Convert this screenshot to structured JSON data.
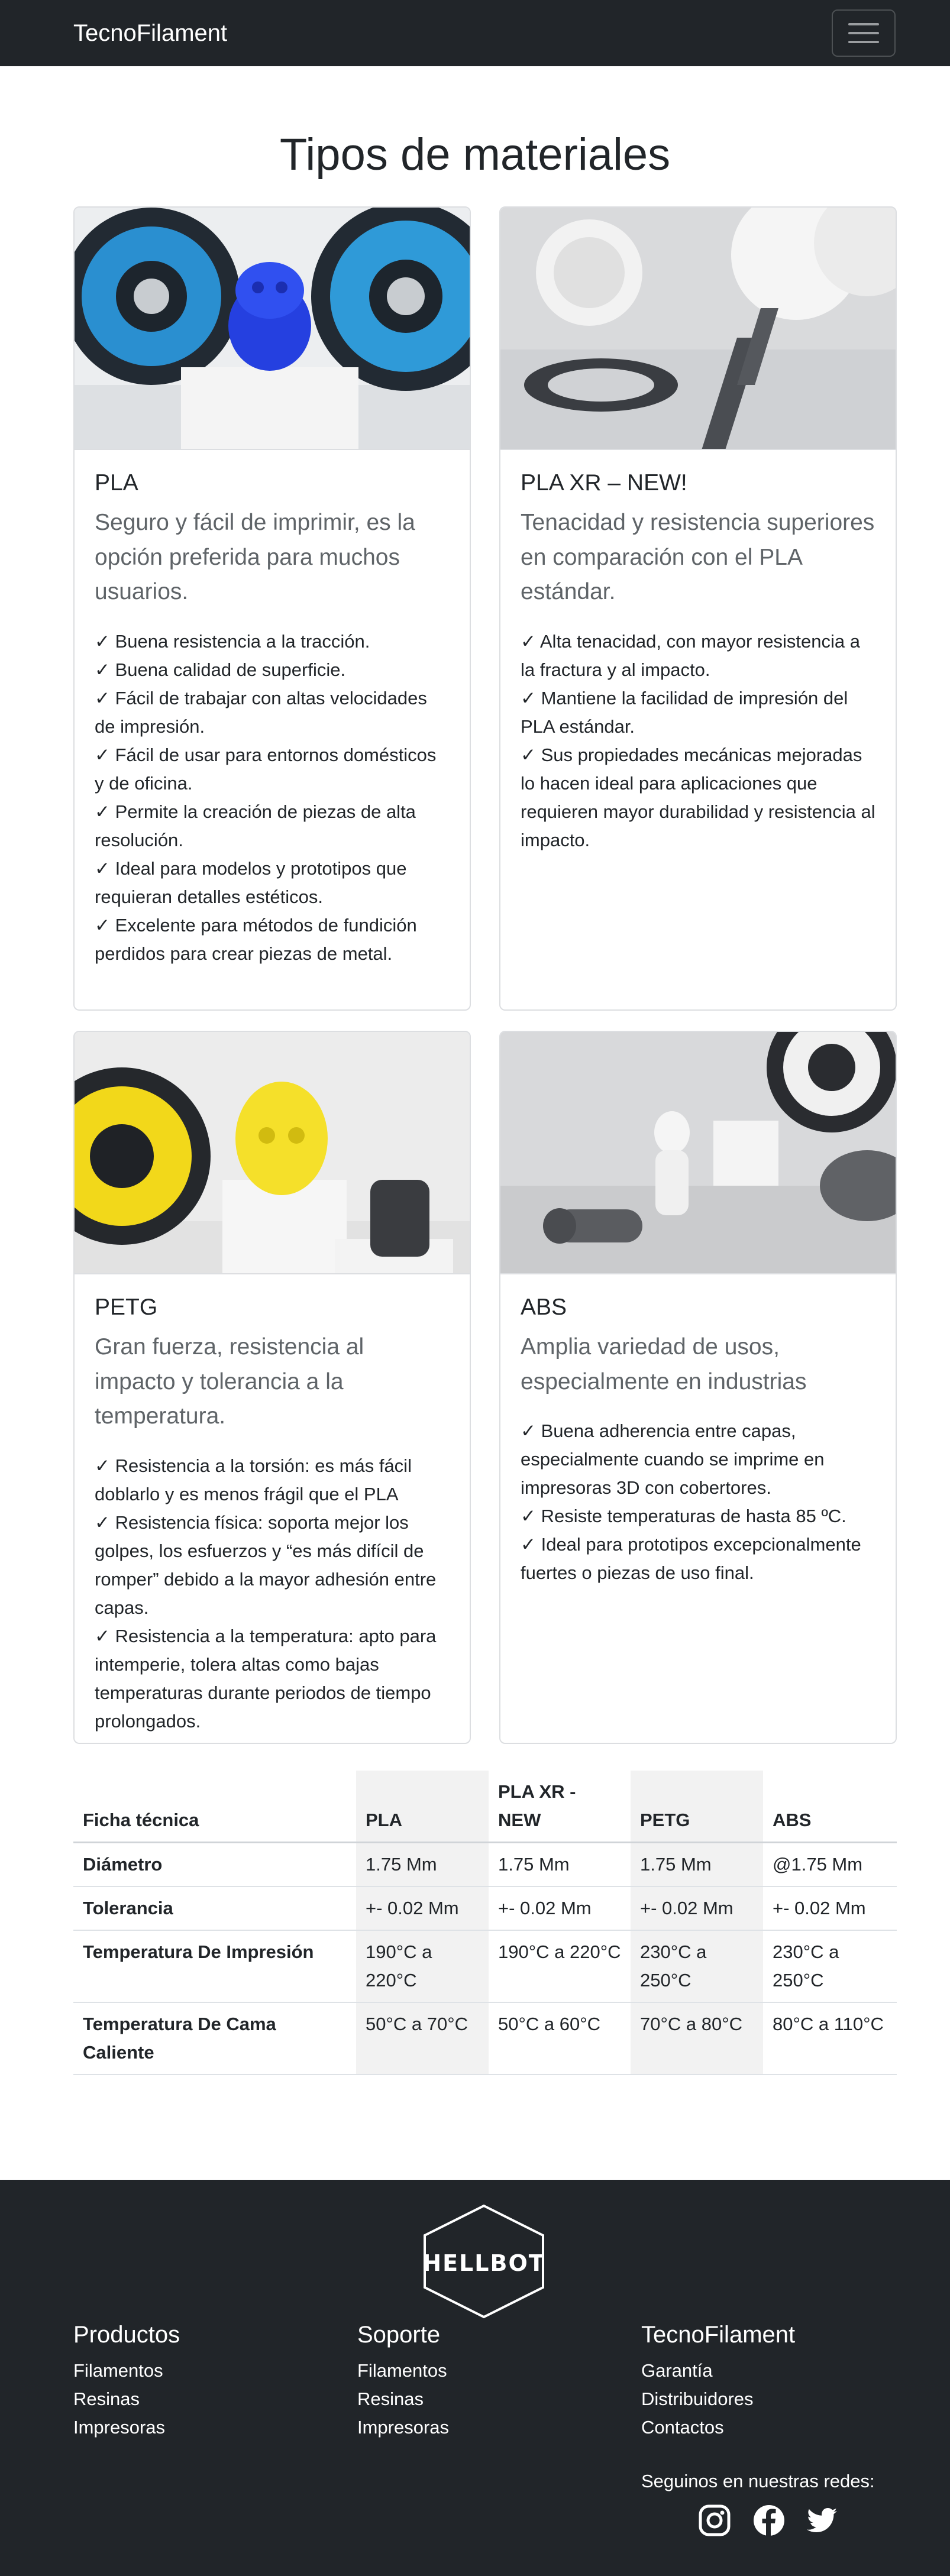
{
  "navbar": {
    "brand": "TecnoFilament"
  },
  "page_title": "Tipos de materiales",
  "cards": [
    {
      "title": "PLA",
      "lead": "Seguro y fácil de imprimir, es la opción preferida para muchos usuarios.",
      "features": [
        "✓ Buena resistencia a la tracción.",
        "✓ Buena calidad de superficie.",
        "✓ Fácil de trabajar con altas velocidades de impresión.",
        "✓ Fácil de usar para entornos domésticos y de oficina.",
        "✓ Permite la creación de piezas de alta resolución.",
        "✓ Ideal para modelos y prototipos que requieran detalles estéticos.",
        "✓ Excelente para métodos de fundición perdidos para crear piezas de metal."
      ]
    },
    {
      "title": "PLA XR – NEW!",
      "lead": "Tenacidad y resistencia superiores en comparación con el PLA estándar.",
      "features": [
        "✓ Alta tenacidad, con mayor resistencia a la fractura y al impacto.",
        "✓ Mantiene la facilidad de impresión del PLA estándar.",
        "✓ Sus propiedades mecánicas mejoradas lo hacen ideal para aplicaciones que requieren mayor durabilidad y resistencia al impacto."
      ]
    },
    {
      "title": "PETG",
      "lead": "Gran fuerza, resistencia al impacto y tolerancia a la temperatura.",
      "features": [
        "✓ Resistencia a la torsión: es más fácil doblarlo y es menos frágil que el PLA",
        "✓ Resistencia física: soporta mejor los golpes, los esfuerzos y “es más difícil de romper” debido a la mayor adhesión entre capas.",
        "✓ Resistencia a la temperatura: apto para intemperie, tolera altas como bajas temperaturas durante periodos de tiempo prolongados."
      ]
    },
    {
      "title": "ABS",
      "lead": "Amplia variedad de usos, especialmente en industrias",
      "features": [
        "✓ Buena adherencia entre capas, especialmente cuando se imprime en impresoras 3D con cobertores.",
        "✓ Resiste temperaturas de hasta 85 ºC.",
        "✓ Ideal para prototipos excepcionalmente fuertes o piezas de uso final."
      ]
    }
  ],
  "spec_table": {
    "headers": [
      "Ficha técnica",
      "PLA",
      "PLA XR - NEW",
      "PETG",
      "ABS"
    ],
    "rows": [
      [
        "Diámetro",
        "1.75 Mm",
        "1.75 Mm",
        "1.75 Mm",
        "@1.75 Mm"
      ],
      [
        "Tolerancia",
        "+- 0.02 Mm",
        "+- 0.02 Mm",
        "+- 0.02 Mm",
        "+- 0.02 Mm"
      ],
      [
        "Temperatura De Impresión",
        "190°C a 220°C",
        "190°C a 220°C",
        "230°C a 250°C",
        "230°C a 250°C"
      ],
      [
        "Temperatura De Cama Caliente",
        "50°C a 70°C",
        "50°C a 60°C",
        "70°C a 80°C",
        "80°C a 110°C"
      ]
    ]
  },
  "footer": {
    "logo_text": "HELLBOT",
    "columns": [
      {
        "title": "Productos",
        "links": [
          "Filamentos",
          "Resinas",
          "Impresoras"
        ]
      },
      {
        "title": "Soporte",
        "links": [
          "Filamentos",
          "Resinas",
          "Impresoras"
        ]
      },
      {
        "title": "TecnoFilament",
        "links": [
          "Garantía",
          "Distribuidores",
          "Contactos"
        ]
      }
    ],
    "social_label": "Seguinos en nuestras redes:",
    "social_icons": [
      "instagram-icon",
      "facebook-icon",
      "twitter-icon"
    ]
  },
  "colors": {
    "navbar": "#212529",
    "footer": "#212529",
    "table_highlight": "#f2f2f2"
  }
}
